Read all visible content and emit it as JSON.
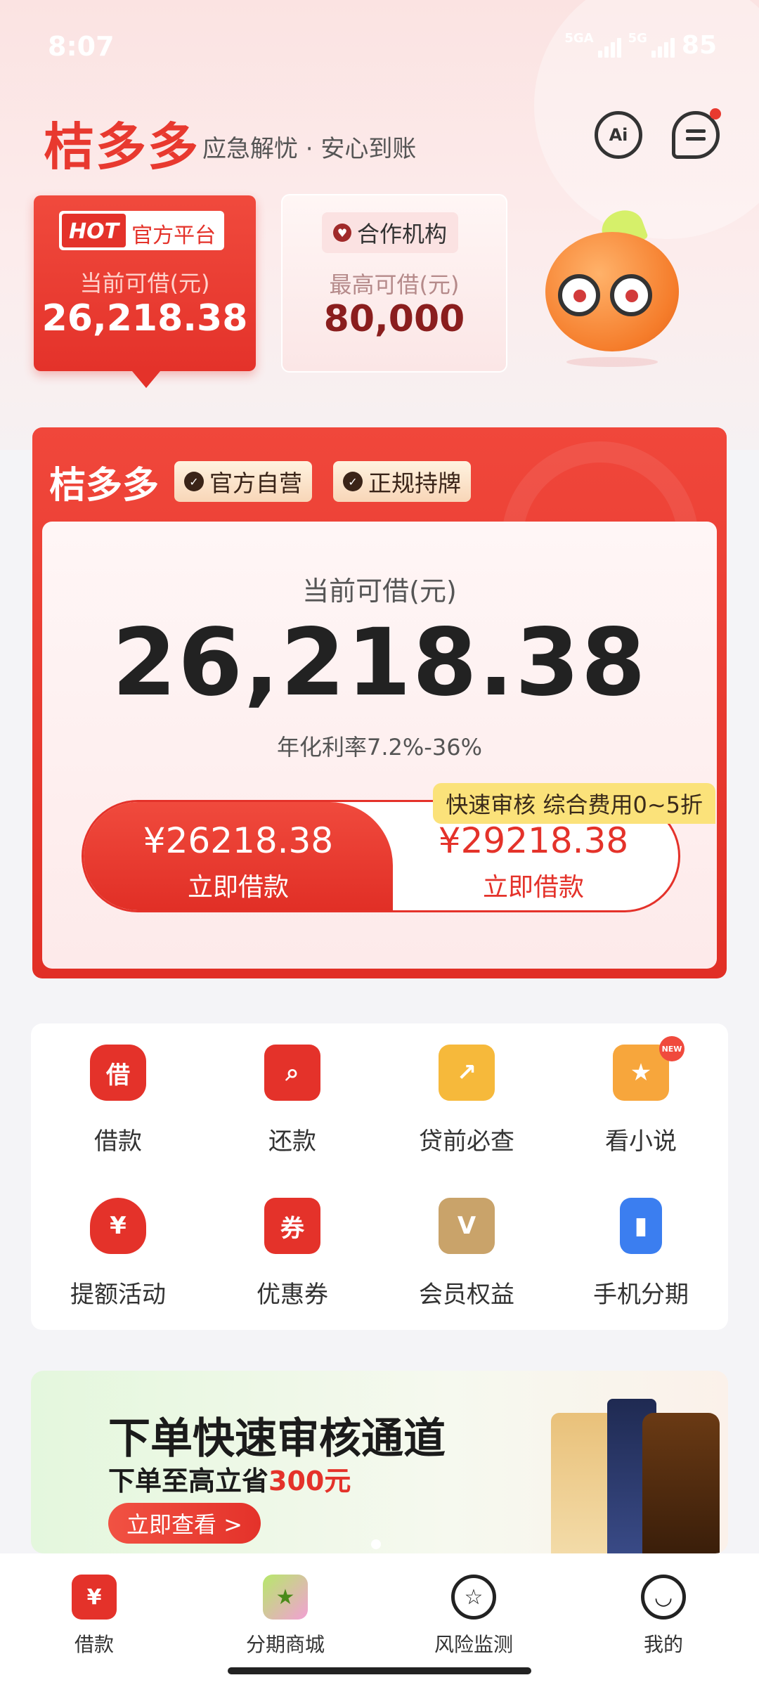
{
  "status_bar": {
    "time": "8:07",
    "network_1": "5GA",
    "network_2": "5G",
    "battery": "85"
  },
  "header": {
    "brand": "桔多多",
    "slogan": "应急解忧 · 安心到账",
    "ai_icon_text": "Ai"
  },
  "platform_cards": {
    "official": {
      "hot": "HOT",
      "tag": "官方平台",
      "label": "当前可借(元)",
      "amount": "26,218.38"
    },
    "partner": {
      "tag": "合作机构",
      "label": "最高可借(元)",
      "amount": "80,000"
    }
  },
  "loan_card": {
    "brand": "桔多多",
    "badges": [
      "官方自营",
      "正规持牌"
    ],
    "label": "当前可借(元)",
    "amount": "26,218.38",
    "rate": "年化利率7.2%-36%",
    "promo": "快速审核 综合费用0~5折",
    "btn_left": {
      "amount": "¥26218.38",
      "action": "立即借款"
    },
    "btn_right": {
      "amount": "¥29218.38",
      "action": "立即借款"
    }
  },
  "services": [
    {
      "label": "借款",
      "icon": "借"
    },
    {
      "label": "还款",
      "icon": ""
    },
    {
      "label": "贷前必查",
      "icon": ""
    },
    {
      "label": "看小说",
      "icon": "",
      "badge": "NEW"
    },
    {
      "label": "提额活动",
      "icon": "¥"
    },
    {
      "label": "优惠券",
      "icon": "券"
    },
    {
      "label": "会员权益",
      "icon": "V"
    },
    {
      "label": "手机分期",
      "icon": ""
    }
  ],
  "banner": {
    "title": "下单快速审核通道",
    "sub_prefix": "下单至高立省",
    "sub_highlight": "300元",
    "button": "立即查看 >"
  },
  "tabbar": [
    {
      "label": "借款",
      "icon": "¥"
    },
    {
      "label": "分期商城",
      "icon": "★"
    },
    {
      "label": "风险监测",
      "icon": ""
    },
    {
      "label": "我的",
      "icon": ""
    }
  ],
  "colors": {
    "brand_red": "#e4322a",
    "promo_yellow": "#fbe27a",
    "page_bg": "#f4f4f7"
  }
}
